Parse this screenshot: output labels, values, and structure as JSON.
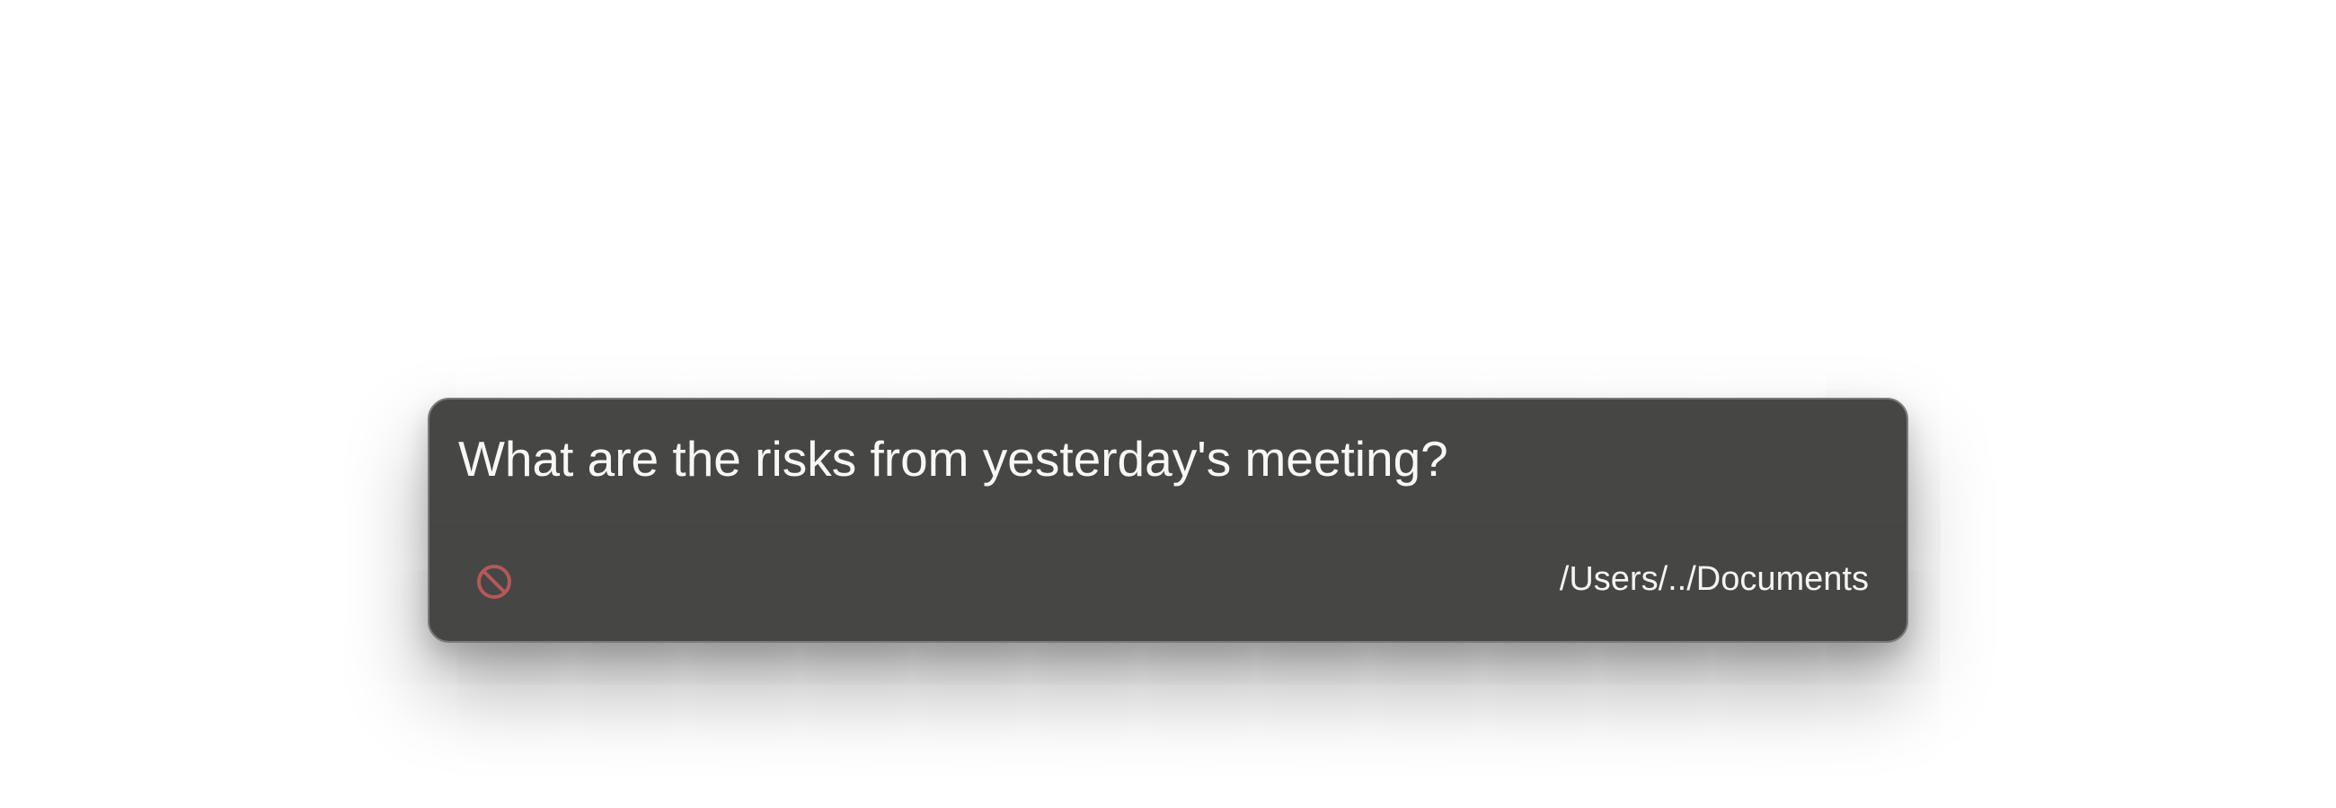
{
  "prompt_bar": {
    "query_value": "What are the risks from yesterday's meeting?",
    "status_icon": "no-entry-icon",
    "status_icon_color": "#b4585a",
    "directory_path": "/Users/../Documents"
  },
  "colors": {
    "panel_background": "#464644",
    "panel_border": "#7a7a78",
    "text": "#f7f7f5",
    "page_background": "#ffffff"
  }
}
